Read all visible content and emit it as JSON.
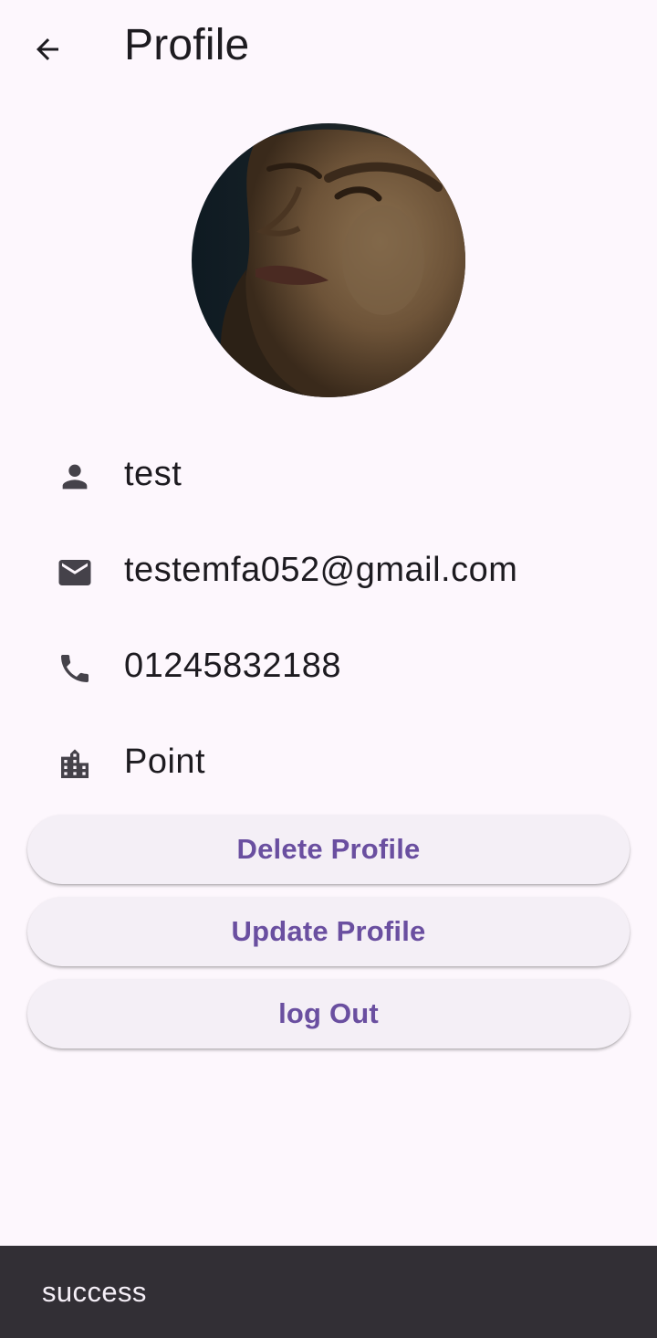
{
  "appbar": {
    "title": "Profile",
    "back_icon": "arrow-back-icon"
  },
  "avatar": {
    "description_icon": "profile-photo"
  },
  "profile": {
    "name": "test",
    "email": "testemfa052@gmail.com",
    "phone": "01245832188",
    "location": "Point"
  },
  "icons": {
    "name": "person-icon",
    "email": "mail-icon",
    "phone": "phone-icon",
    "location": "building-icon"
  },
  "buttons": {
    "delete": "Delete Profile",
    "update": "Update Profile",
    "logout": "log Out"
  },
  "snackbar": {
    "message": "success"
  },
  "colors": {
    "background": "#fdf7fd",
    "button_bg": "#f4eff6",
    "button_text": "#6a4fa0",
    "icon": "#45424a",
    "snackbar_bg": "#322f35"
  }
}
